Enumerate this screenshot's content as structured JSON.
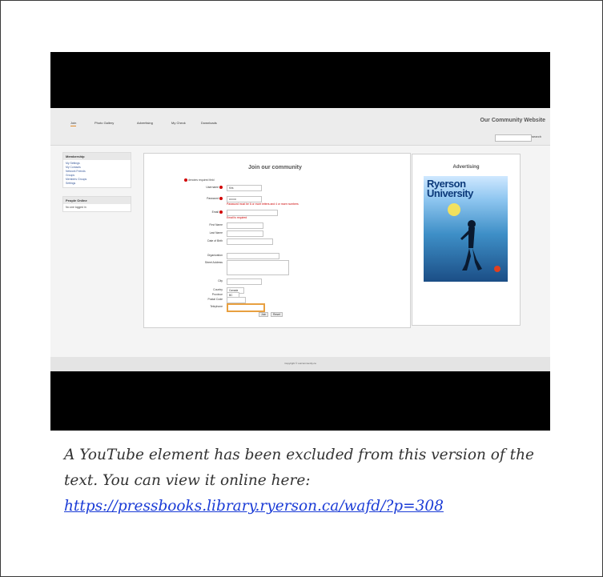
{
  "site": {
    "title": "Our Community Website",
    "tabs": [
      "Join",
      "Photo Gallery",
      "Advertising",
      "My Check",
      "Downloads"
    ],
    "search_button": "search",
    "sidebar": {
      "membership_title": "Membership",
      "membership_items": [
        "My Settings",
        "My Contacts",
        "Network Friends",
        "Groups",
        "Members Groups",
        "Settings"
      ],
      "online_title": "People Online",
      "online_text": "No one logged in"
    },
    "form": {
      "title": "Join our community",
      "required_note": "denotes required field",
      "labels": {
        "username": "Username",
        "password": "Password",
        "email": "Email",
        "first_name": "First Name",
        "last_name": "Last Name",
        "dob": "Date of Birth",
        "organization": "Organization",
        "street": "Street Address",
        "city": "City",
        "country": "Country",
        "province": "Province",
        "postal": "Postal Code",
        "telephone": "Telephone"
      },
      "values": {
        "username": "Kris",
        "password": "••••••••",
        "country": "Canada",
        "province": "BC"
      },
      "errors": {
        "password": "Password must be 6 or more letters and 4 or more numbers",
        "email": "Email is required"
      },
      "join_button": "Join",
      "reset_button": "Reset"
    },
    "ad": {
      "title": "Advertising",
      "magazine_line1": "Ryerson",
      "magazine_line2": "University"
    },
    "copyright": "Copyright © ourcommunity.ca"
  },
  "caption": {
    "text": "A YouTube element has been excluded from this version of the text. You can view it online here:",
    "link": "https://pressbooks.library.ryerson.ca/wafd/?p=308"
  },
  "colors": {
    "error": "#cc0000",
    "accent": "#e8a040",
    "link": "#1a3bd6"
  }
}
